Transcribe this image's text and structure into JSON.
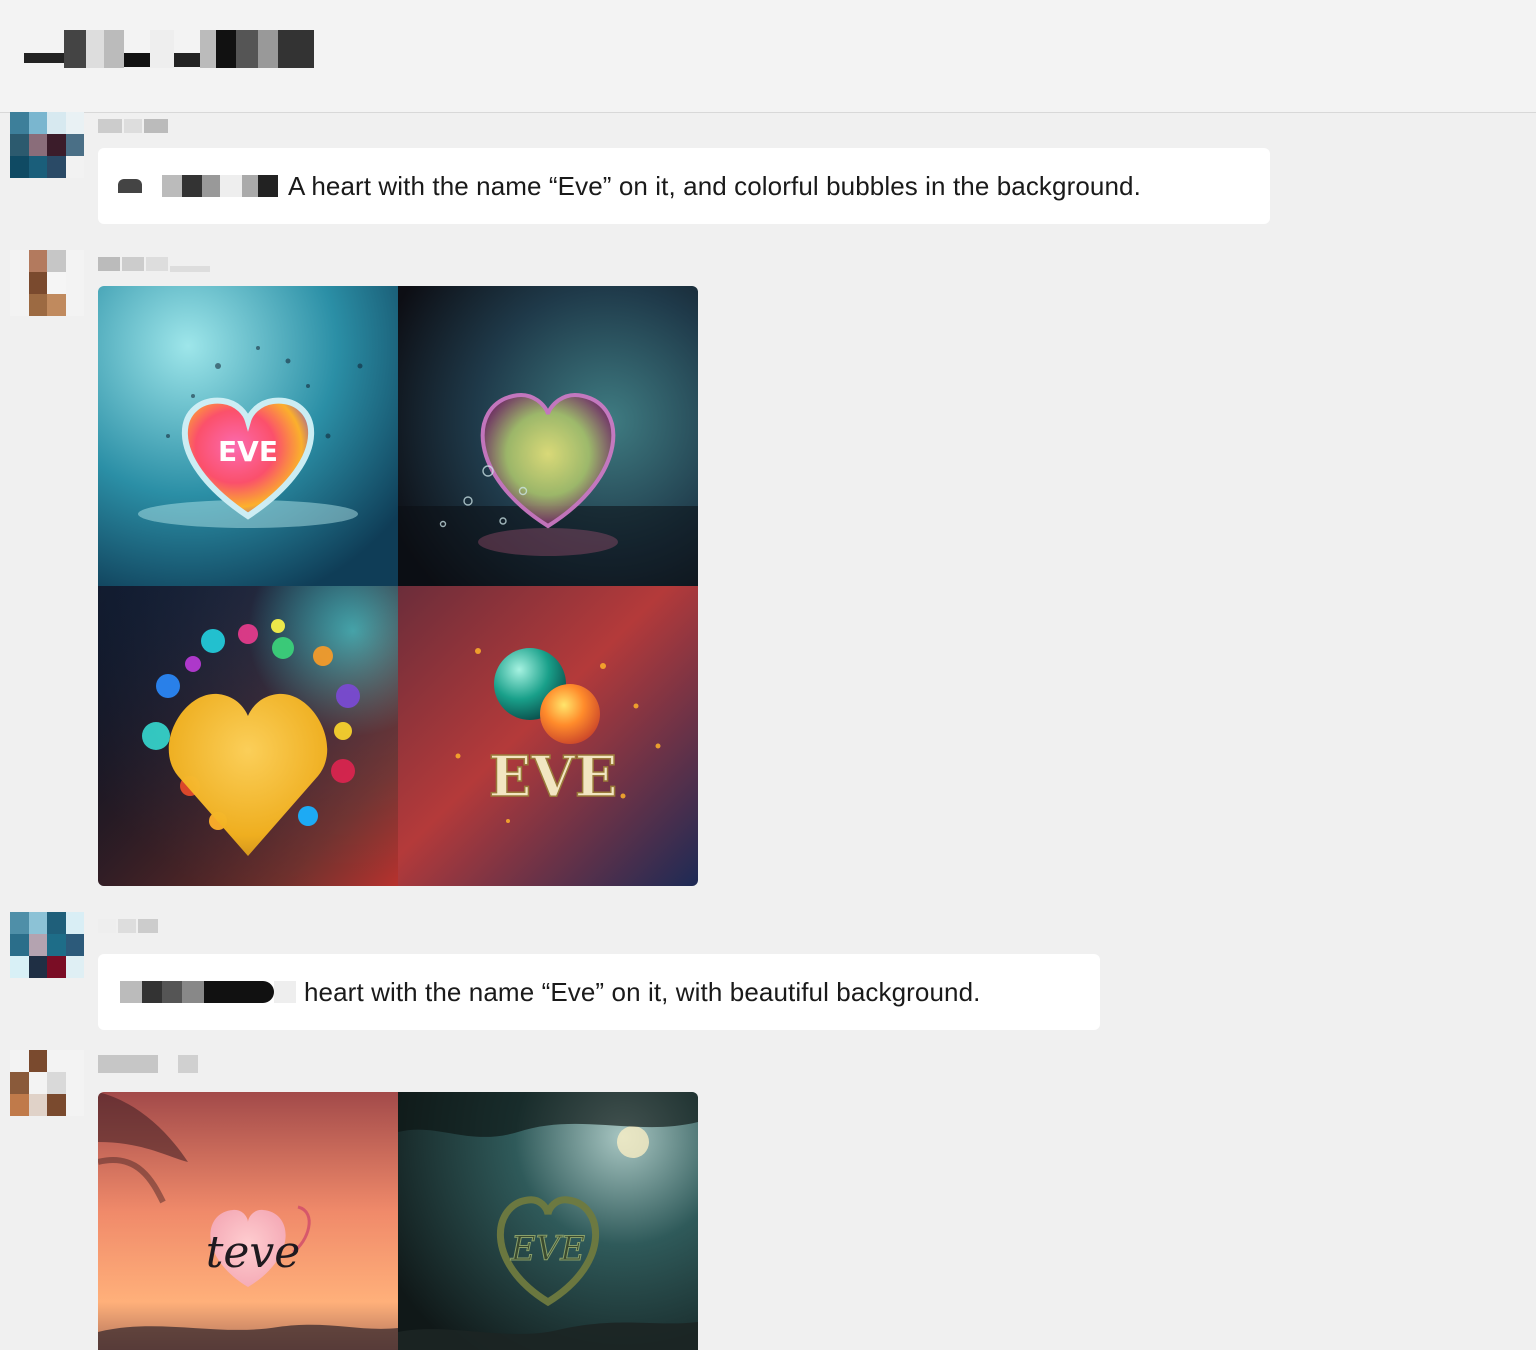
{
  "header": {
    "title": ""
  },
  "messages": [
    {
      "type": "prompt",
      "text": "A heart with the name “Eve” on it, and colorful bubbles in the background."
    },
    {
      "type": "image_grid",
      "tiles": [
        "heart-splash-eve",
        "glass-heart",
        "yellow-heart-bubbles",
        "eve-letters-spheres"
      ]
    },
    {
      "type": "prompt",
      "text": "heart with the name “Eve” on it, with beautiful background."
    },
    {
      "type": "image_grid",
      "tiles": [
        "sunset-heart-teve",
        "forest-vine-heart-eve"
      ]
    }
  ],
  "tile_text": {
    "eve1": "EVE",
    "eve4": "EVE",
    "teve": "teve",
    "eve6": "EVE"
  },
  "colors": {
    "background": "#f0f0f0",
    "bubble": "#ffffff",
    "divider": "#d8d8d8"
  }
}
